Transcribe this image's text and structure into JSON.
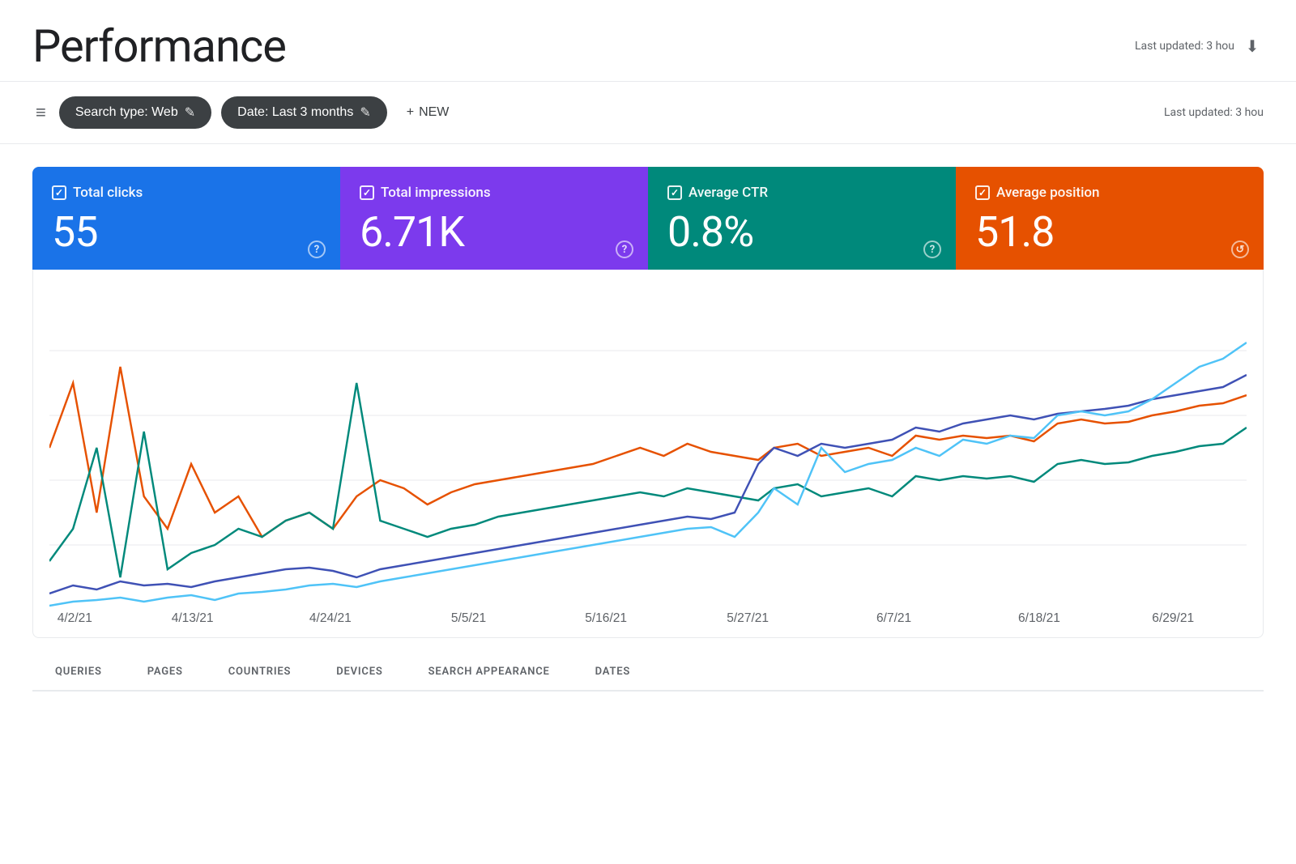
{
  "header": {
    "title": "Performance",
    "last_updated": "Last updated: 3 hou"
  },
  "toolbar": {
    "search_type_label": "Search type: Web",
    "date_label": "Date: Last 3 months",
    "new_label": "NEW",
    "filter_icon": "≡",
    "edit_icon": "✎",
    "plus_icon": "+"
  },
  "metrics": [
    {
      "id": "total-clicks",
      "label": "Total clicks",
      "value": "55",
      "color": "blue",
      "info": "?"
    },
    {
      "id": "total-impressions",
      "label": "Total impressions",
      "value": "6.71K",
      "color": "purple",
      "info": "?"
    },
    {
      "id": "average-ctr",
      "label": "Average CTR",
      "value": "0.8%",
      "color": "teal",
      "info": "?"
    },
    {
      "id": "average-position",
      "label": "Average position",
      "value": "51.8",
      "color": "orange",
      "info": "↺"
    }
  ],
  "chart": {
    "x_labels": [
      "4/2/21",
      "4/13/21",
      "4/24/21",
      "5/5/21",
      "5/16/21",
      "5/27/21",
      "6/7/21",
      "6/18/21",
      "6/29/21"
    ],
    "series": {
      "clicks": {
        "color": "#1a73e8",
        "label": "Total clicks"
      },
      "impressions": {
        "color": "#7c3aed",
        "label": "Total impressions"
      },
      "ctr": {
        "color": "#e65100",
        "label": "Average CTR"
      },
      "position": {
        "color": "#00897b",
        "label": "Average position"
      }
    }
  },
  "tabs": [
    {
      "id": "queries",
      "label": "QUERIES",
      "active": false
    },
    {
      "id": "pages",
      "label": "PAGES",
      "active": false
    },
    {
      "id": "countries",
      "label": "COUNTRIES",
      "active": false
    },
    {
      "id": "devices",
      "label": "DEVICES",
      "active": false
    },
    {
      "id": "search-appearance",
      "label": "SEARCH APPEARANCE",
      "active": false
    },
    {
      "id": "dates",
      "label": "DATES",
      "active": false
    }
  ]
}
